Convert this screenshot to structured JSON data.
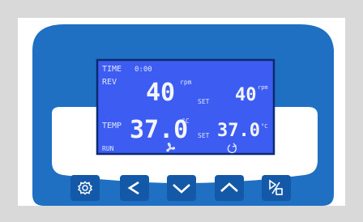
{
  "display": {
    "time_label": "TIME",
    "time_value": "0:00",
    "rev_label": "REV",
    "rev_value": "40",
    "rev_unit": "rpm",
    "rev_set_label": "SET",
    "rev_set_value": "40",
    "rev_set_unit": "rpm",
    "temp_label": "TEMP",
    "temp_value": "37.0",
    "temp_unit": "°C",
    "temp_set_label": "SET",
    "temp_set_value": "37.0",
    "temp_set_unit": "°C",
    "run_label": "RUN",
    "fan_icon": "fan-icon",
    "rotation_icon": "rotation-icon"
  },
  "colors": {
    "panel_blue": "#1f6fc2",
    "panel_blue_dark": "#1458a8",
    "lcd_blue": "#3d5cf2",
    "lcd_border": "#0d2a70",
    "background": "#d9d9d9"
  },
  "buttons": [
    {
      "name": "settings-button",
      "icon": "gear-icon"
    },
    {
      "name": "left-button",
      "icon": "chevron-left-icon"
    },
    {
      "name": "down-button",
      "icon": "chevron-down-icon"
    },
    {
      "name": "up-button",
      "icon": "chevron-up-icon"
    },
    {
      "name": "start-stop-button",
      "icon": "play-stop-icon"
    }
  ]
}
